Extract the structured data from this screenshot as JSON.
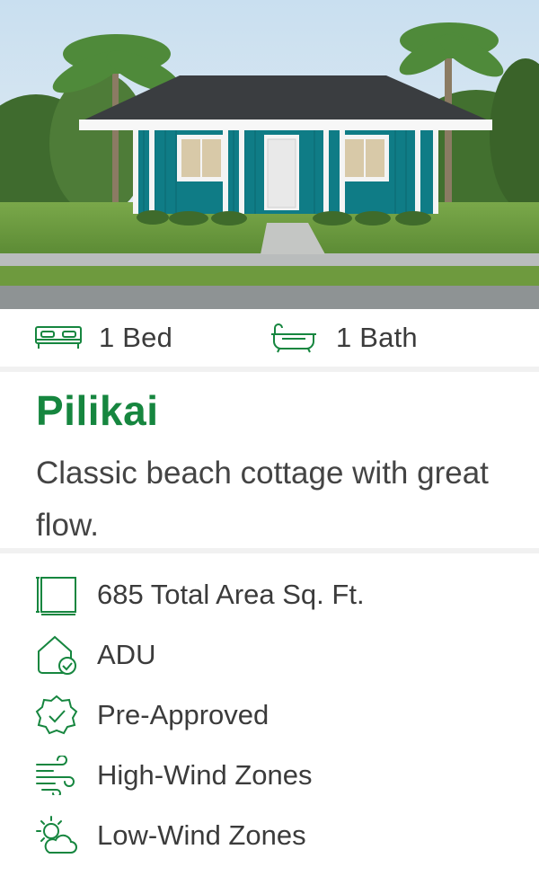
{
  "listing": {
    "image_alt": "Teal beach cottage with dark hip roof",
    "specs": {
      "beds": "1 Bed",
      "baths": "1 Bath"
    },
    "name": "Pilikai",
    "description": "Classic beach cottage with great flow.",
    "features": [
      {
        "icon": "floor-plan-icon",
        "label": "685 Total Area Sq. Ft."
      },
      {
        "icon": "house-check-icon",
        "label": "ADU"
      },
      {
        "icon": "badge-check-icon",
        "label": "Pre-Approved"
      },
      {
        "icon": "wind-icon",
        "label": "High-Wind Zones"
      },
      {
        "icon": "sun-cloud-icon",
        "label": "Low-Wind Zones"
      }
    ]
  },
  "colors": {
    "accent_green": "#16863f",
    "house_teal": "#0f7c86",
    "roof": "#3a3d40"
  }
}
